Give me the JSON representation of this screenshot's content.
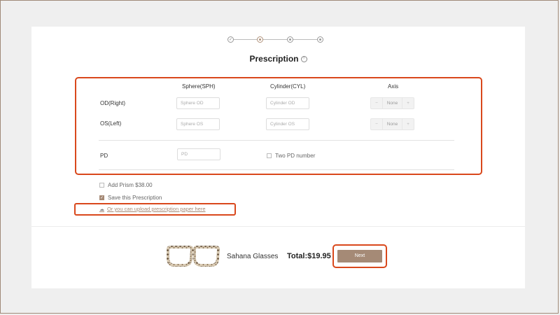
{
  "stepper": {
    "total_steps": 4,
    "current_step": 2
  },
  "title": "Prescription",
  "icons": {
    "help": "question-circle-icon",
    "upload": "cloud-upload-icon",
    "check": "check-icon"
  },
  "table": {
    "headers": {
      "sphere": "Sphere(SPH)",
      "cylinder": "Cylinder(CYL)",
      "axis": "Axis"
    },
    "rows": [
      {
        "label": "OD(Right)",
        "sphere_placeholder": "Sphere OD",
        "cylinder_placeholder": "Cylinder OD",
        "axis_value": "None"
      },
      {
        "label": "OS(Left)",
        "sphere_placeholder": "Sphere OS",
        "cylinder_placeholder": "Cylinder OS",
        "axis_value": "None"
      }
    ],
    "pd": {
      "label": "PD",
      "placeholder": "PD",
      "two_pd_label": "Two PD number",
      "two_pd_checked": false
    }
  },
  "options": {
    "add_prism": {
      "label": "Add Prism $38.00",
      "checked": false
    },
    "save_prescription": {
      "label": "Save this Prescription",
      "checked": true
    },
    "upload_link": "Or you can upload prescription paper here"
  },
  "footer": {
    "product_name": "Sahana Glasses",
    "total": "Total:$19.95",
    "next_label": "Next"
  },
  "colors": {
    "accent": "#a58a76",
    "highlight": "#d9481c",
    "background": "#efefef"
  }
}
